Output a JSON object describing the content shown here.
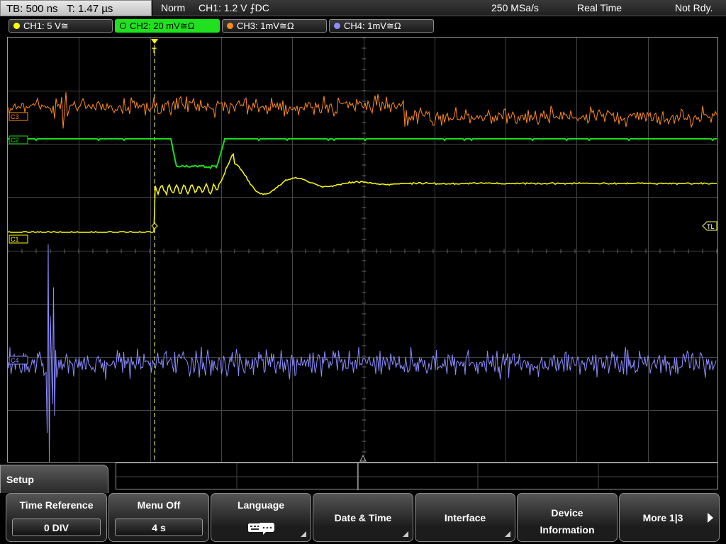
{
  "status": {
    "timebase": "TB: 500 ns",
    "trigger_time": "T: 1.47 µs",
    "trigger_mode": "Norm",
    "trigger_source": "CH1: 1.2 V",
    "trigger_coupling": "⨍DC",
    "sample_rate": "250 MSa/s",
    "acq_mode": "Real Time",
    "state": "Not Rdy."
  },
  "channels": [
    {
      "label": "CH1: 5 V≅",
      "color": "#ffff00",
      "active": false
    },
    {
      "label": "CH2: 20 mV≅Ω",
      "color": "#00ff00",
      "active": true
    },
    {
      "label": "CH3: 1mV≅Ω",
      "color": "#ff8c1a",
      "active": false
    },
    {
      "label": "CH4: 1mV≅Ω",
      "color": "#8c8cff",
      "active": false
    }
  ],
  "markers": {
    "c1": "C1",
    "c2": "C2",
    "c3": "C3",
    "c4": "C4",
    "trigger_level": "TL",
    "trigger_pos": "T"
  },
  "menu": {
    "title": "Setup",
    "softkeys": {
      "time_reference": {
        "label": "Time Reference",
        "value": "0 DIV"
      },
      "menu_off": {
        "label": "Menu Off",
        "value": "4 s"
      },
      "language": {
        "label": "Language"
      },
      "date_time": {
        "label": "Date & Time"
      },
      "interface": {
        "label": "Interface"
      },
      "device_info": {
        "label1": "Device",
        "label2": "Information"
      },
      "more": {
        "label": "More 1|3"
      }
    }
  }
}
